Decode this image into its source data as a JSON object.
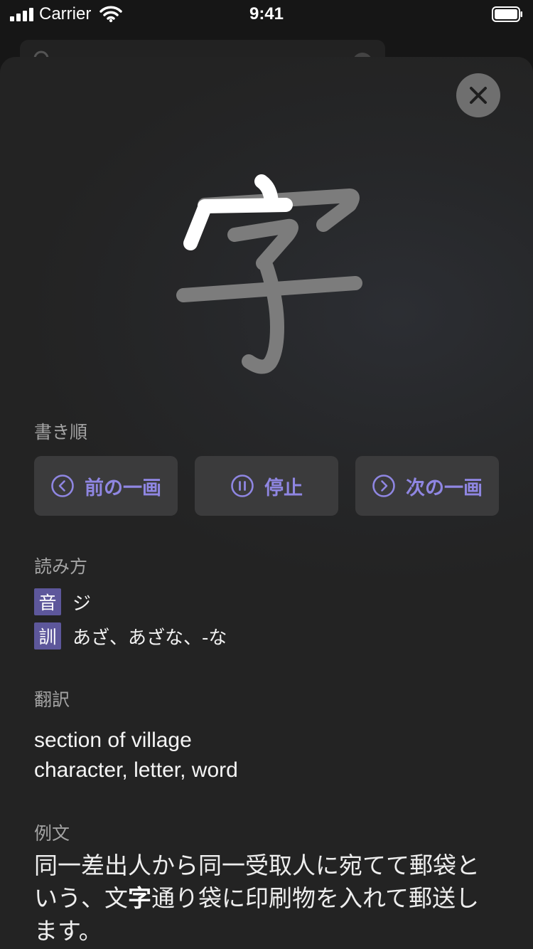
{
  "status_bar": {
    "carrier": "Carrier",
    "time": "9:41"
  },
  "kanji": {
    "character": "字"
  },
  "sections": {
    "stroke_order": "書き順",
    "readings": "読み方",
    "translation": "翻訳",
    "example": "例文"
  },
  "controls": {
    "prev_label": "前の一画",
    "pause_label": "停止",
    "next_label": "次の一画"
  },
  "readings": {
    "on_badge": "音",
    "on_value": "ジ",
    "kun_badge": "訓",
    "kun_value": "あざ、あざな、-な"
  },
  "translation": {
    "lines": [
      "section of village",
      "character, letter, word"
    ]
  },
  "example": {
    "before": "同一差出人から同一受取人に宛てて郵袋という、文",
    "highlight": "字",
    "after": "通り袋に印刷物を入れて郵送します。"
  },
  "colors": {
    "accent": "#8f86e2",
    "badge": "#5d579b",
    "button_bg": "#3b3b3c"
  },
  "icons": {
    "prev": "chevron-left-circle-icon",
    "pause": "pause-circle-icon",
    "next": "chevron-right-circle-icon",
    "close": "close-icon"
  }
}
